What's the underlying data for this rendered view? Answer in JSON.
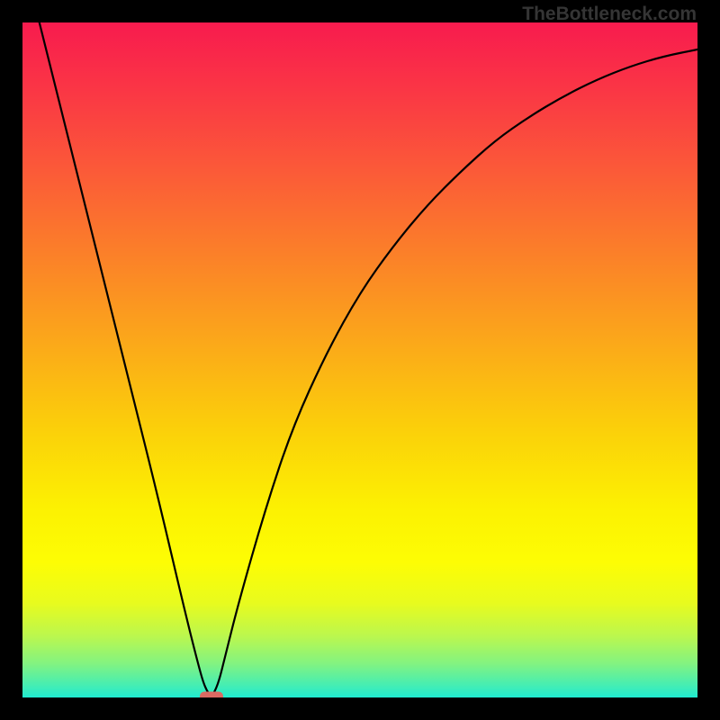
{
  "watermark": "TheBottleneck.com",
  "chart_data": {
    "type": "line",
    "title": "",
    "xlabel": "",
    "ylabel": "",
    "xlim": [
      0,
      100
    ],
    "ylim": [
      0,
      100
    ],
    "series": [
      {
        "name": "bottleneck-curve",
        "x": [
          0,
          4,
          8,
          12,
          16,
          20,
          24,
          26,
          27,
          28,
          29,
          30,
          32,
          36,
          40,
          45,
          50,
          55,
          60,
          65,
          70,
          75,
          80,
          85,
          90,
          95,
          100
        ],
        "y": [
          110,
          94,
          78,
          62,
          46,
          30,
          13,
          5,
          1.5,
          0,
          2,
          6,
          14,
          28,
          40,
          51,
          60,
          67,
          73,
          78,
          82.5,
          86,
          89,
          91.5,
          93.5,
          95,
          96
        ]
      }
    ],
    "marker": {
      "x": 28,
      "y": 0,
      "shape": "pill",
      "color": "#db6a63"
    },
    "gradient": {
      "stops": [
        {
          "offset": 0.0,
          "color": "#f81b4e"
        },
        {
          "offset": 0.1,
          "color": "#fa3645"
        },
        {
          "offset": 0.22,
          "color": "#fb5a38"
        },
        {
          "offset": 0.35,
          "color": "#fb8228"
        },
        {
          "offset": 0.48,
          "color": "#fbaa19"
        },
        {
          "offset": 0.6,
          "color": "#fbcf0a"
        },
        {
          "offset": 0.72,
          "color": "#fcf102"
        },
        {
          "offset": 0.8,
          "color": "#fdfd04"
        },
        {
          "offset": 0.86,
          "color": "#e8fb1e"
        },
        {
          "offset": 0.91,
          "color": "#baf74f"
        },
        {
          "offset": 0.95,
          "color": "#82f381"
        },
        {
          "offset": 0.985,
          "color": "#3fedb8"
        },
        {
          "offset": 1.0,
          "color": "#1febd0"
        }
      ]
    }
  }
}
